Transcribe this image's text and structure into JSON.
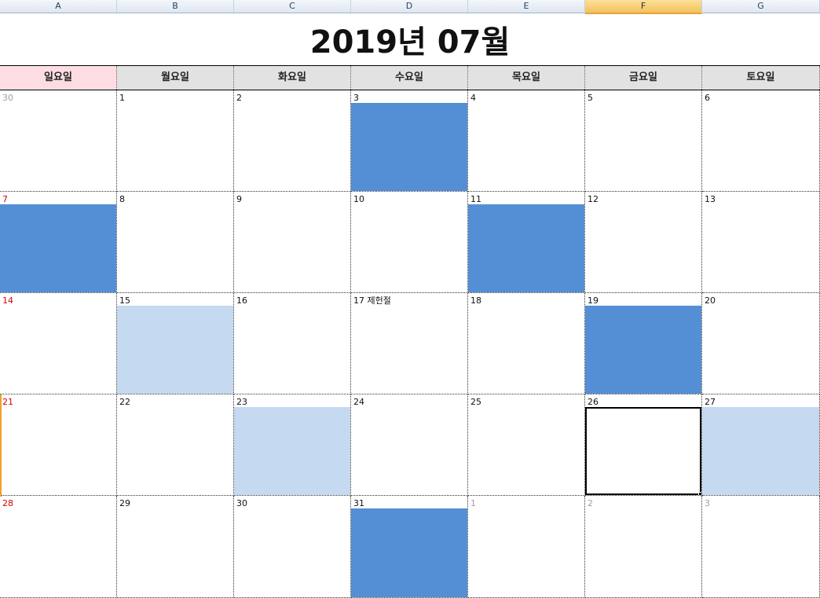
{
  "columns": [
    {
      "label": "A",
      "active": false
    },
    {
      "label": "B",
      "active": false
    },
    {
      "label": "C",
      "active": false
    },
    {
      "label": "D",
      "active": false
    },
    {
      "label": "E",
      "active": false
    },
    {
      "label": "F",
      "active": true
    },
    {
      "label": "G",
      "active": false
    }
  ],
  "title": "2019년 07월",
  "weekdays": [
    "일요일",
    "월요일",
    "화요일",
    "수요일",
    "목요일",
    "금요일",
    "토요일"
  ],
  "colors": {
    "dark_fill": "#548fd6",
    "light_fill": "#c5d9f0",
    "sunday_text": "#d80000",
    "other_month_text": "#a0a0a0",
    "sunday_header": "#fddde2"
  },
  "weeks": [
    [
      {
        "label": "30",
        "other": true,
        "fill": null
      },
      {
        "label": "1",
        "fill": null
      },
      {
        "label": "2",
        "fill": null
      },
      {
        "label": "3",
        "fill": "dark"
      },
      {
        "label": "4",
        "fill": null
      },
      {
        "label": "5",
        "fill": null
      },
      {
        "label": "6",
        "fill": null
      }
    ],
    [
      {
        "label": "7",
        "fill": "dark"
      },
      {
        "label": "8",
        "fill": null
      },
      {
        "label": "9",
        "fill": null
      },
      {
        "label": "10",
        "fill": null
      },
      {
        "label": "11",
        "fill": "dark"
      },
      {
        "label": "12",
        "fill": null
      },
      {
        "label": "13",
        "fill": null
      }
    ],
    [
      {
        "label": "14",
        "fill": null
      },
      {
        "label": "15",
        "fill": "light"
      },
      {
        "label": "16",
        "fill": null
      },
      {
        "label": "17 제헌절",
        "fill": null
      },
      {
        "label": "18",
        "fill": null
      },
      {
        "label": "19",
        "fill": "dark"
      },
      {
        "label": "20",
        "fill": null
      }
    ],
    [
      {
        "label": "21",
        "fill": null
      },
      {
        "label": "22",
        "fill": null
      },
      {
        "label": "23",
        "fill": "light"
      },
      {
        "label": "24",
        "fill": null
      },
      {
        "label": "25",
        "fill": null
      },
      {
        "label": "26",
        "fill": null,
        "selected": true
      },
      {
        "label": "27",
        "fill": "light"
      }
    ],
    [
      {
        "label": "28",
        "fill": null
      },
      {
        "label": "29",
        "fill": null
      },
      {
        "label": "30",
        "fill": null
      },
      {
        "label": "31",
        "fill": "dark"
      },
      {
        "label": "1",
        "other": true,
        "fill": null
      },
      {
        "label": "2",
        "other": true,
        "fill": null
      },
      {
        "label": "3",
        "other": true,
        "fill": null
      }
    ]
  ]
}
